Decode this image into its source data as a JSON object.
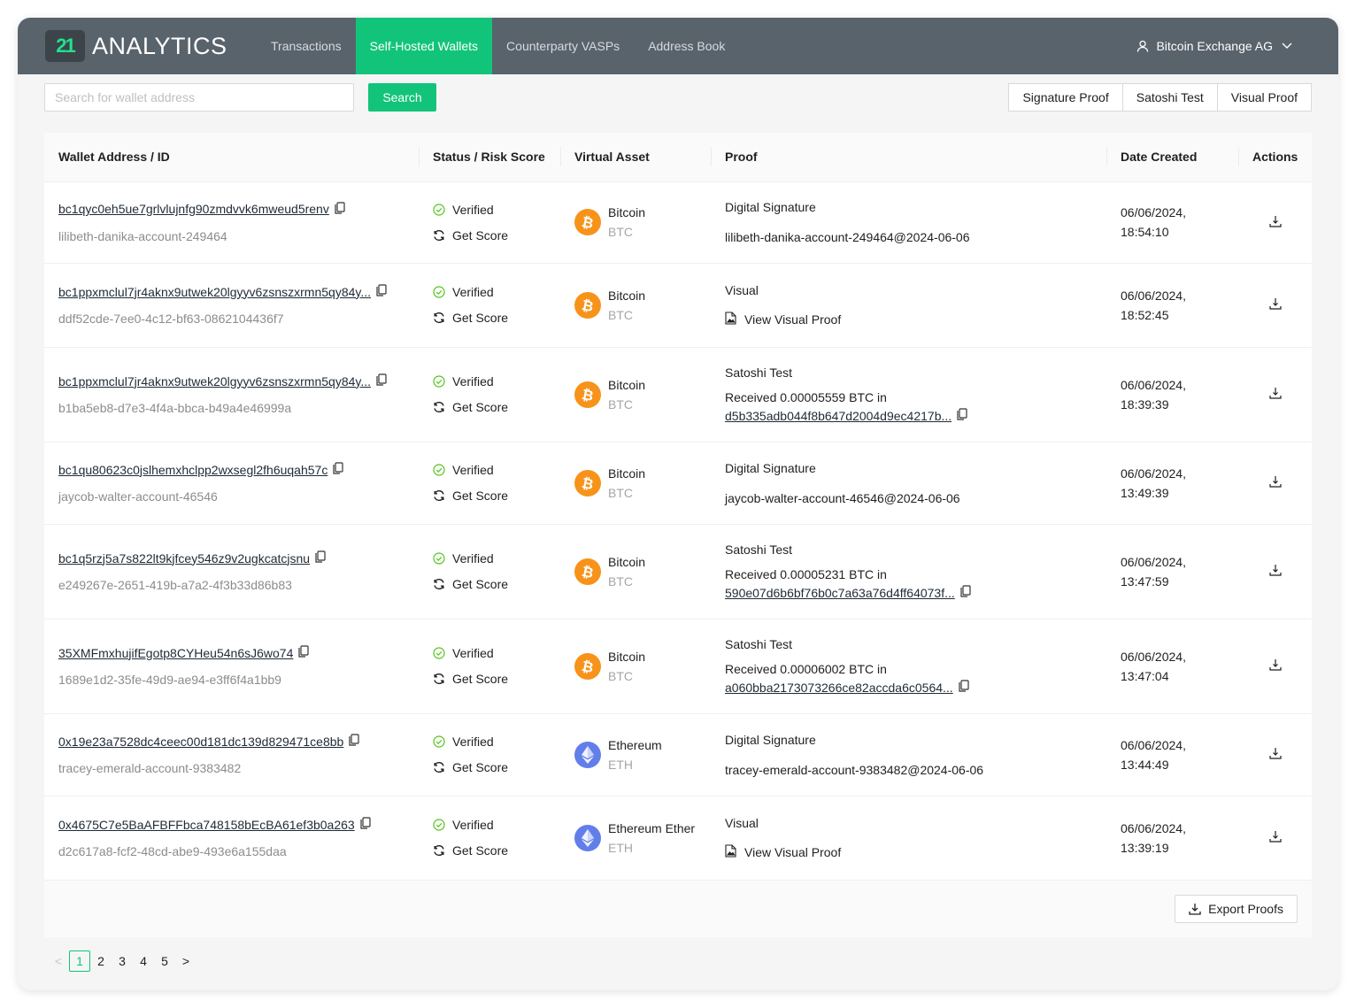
{
  "header": {
    "logo_badge": "21",
    "logo_text": "ANALYTICS",
    "nav": [
      {
        "label": "Transactions",
        "active": false
      },
      {
        "label": "Self-Hosted Wallets",
        "active": true
      },
      {
        "label": "Counterparty VASPs",
        "active": false
      },
      {
        "label": "Address Book",
        "active": false
      }
    ],
    "user": "Bitcoin Exchange AG",
    "user_icon": "user-icon",
    "dropdown_icon": "chevron-down-icon"
  },
  "toolbar": {
    "search_placeholder": "Search for wallet address",
    "search_value": "",
    "search_label": "Search",
    "proof_buttons": [
      "Signature Proof",
      "Satoshi Test",
      "Visual Proof"
    ]
  },
  "table": {
    "columns": [
      "Wallet Address / ID",
      "Status / Risk Score",
      "Virtual Asset",
      "Proof",
      "Date Created",
      "Actions"
    ],
    "rows": [
      {
        "address": "bc1qyc0eh5ue7grlvlujnfg90zmdvvk6mweud5renv",
        "id": "lilibeth-danika-account-249464",
        "status": "Verified",
        "score_label": "Get Score",
        "asset": "Bitcoin",
        "ticker": "BTC",
        "coin": "btc",
        "proof_type": "Digital Signature",
        "proof_kind": "signature",
        "proof_detail": "lilibeth-danika-account-249464@2024-06-06",
        "date": "06/06/2024,",
        "time": "18:54:10"
      },
      {
        "address": "bc1ppxmclul7jr4aknx9utwek20lgyyv6zsnszxrmn5qy84y...",
        "id": "ddf52cde-7ee0-4c12-bf63-0862104436f7",
        "status": "Verified",
        "score_label": "Get Score",
        "asset": "Bitcoin",
        "ticker": "BTC",
        "coin": "btc",
        "proof_type": "Visual",
        "proof_kind": "visual",
        "proof_detail": "View Visual Proof",
        "date": "06/06/2024,",
        "time": "18:52:45"
      },
      {
        "address": "bc1ppxmclul7jr4aknx9utwek20lgyyv6zsnszxrmn5qy84y...",
        "id": "b1ba5eb8-d7e3-4f4a-bbca-b49a4e46999a",
        "status": "Verified",
        "score_label": "Get Score",
        "asset": "Bitcoin",
        "ticker": "BTC",
        "coin": "btc",
        "proof_type": "Satoshi Test",
        "proof_kind": "satoshi",
        "proof_detail": "Received 0.00005559 BTC in",
        "proof_hash": "d5b335adb044f8b647d2004d9ec4217b...",
        "date": "06/06/2024,",
        "time": "18:39:39"
      },
      {
        "address": "bc1qu80623c0jslhemxhclpp2wxsegl2fh6uqah57c",
        "id": "jaycob-walter-account-46546",
        "status": "Verified",
        "score_label": "Get Score",
        "asset": "Bitcoin",
        "ticker": "BTC",
        "coin": "btc",
        "proof_type": "Digital Signature",
        "proof_kind": "signature",
        "proof_detail": "jaycob-walter-account-46546@2024-06-06",
        "date": "06/06/2024,",
        "time": "13:49:39"
      },
      {
        "address": "bc1q5rzj5a7s822lt9kjfcey546z9v2ugkcatcjsnu",
        "id": "e249267e-2651-419b-a7a2-4f3b33d86b83",
        "status": "Verified",
        "score_label": "Get Score",
        "asset": "Bitcoin",
        "ticker": "BTC",
        "coin": "btc",
        "proof_type": "Satoshi Test",
        "proof_kind": "satoshi",
        "proof_detail": "Received 0.00005231 BTC in",
        "proof_hash": "590e07d6b6bf76b0c7a63a76d4ff64073f...",
        "date": "06/06/2024,",
        "time": "13:47:59"
      },
      {
        "address": "35XMFmxhujifEgotp8CYHeu54n6sJ6wo74",
        "id": "1689e1d2-35fe-49d9-ae94-e3ff6f4a1bb9",
        "status": "Verified",
        "score_label": "Get Score",
        "asset": "Bitcoin",
        "ticker": "BTC",
        "coin": "btc",
        "proof_type": "Satoshi Test",
        "proof_kind": "satoshi",
        "proof_detail": "Received 0.00006002 BTC in",
        "proof_hash": "a060bba2173073266ce82accda6c0564...",
        "date": "06/06/2024,",
        "time": "13:47:04"
      },
      {
        "address": "0x19e23a7528dc4ceec00d181dc139d829471ce8bb",
        "id": "tracey-emerald-account-9383482",
        "status": "Verified",
        "score_label": "Get Score",
        "asset": "Ethereum",
        "ticker": "ETH",
        "coin": "eth",
        "proof_type": "Digital Signature",
        "proof_kind": "signature",
        "proof_detail": "tracey-emerald-account-9383482@2024-06-06",
        "date": "06/06/2024,",
        "time": "13:44:49"
      },
      {
        "address": "0x4675C7e5BaAFBFFbca748158bEcBA61ef3b0a263",
        "id": "d2c617a8-fcf2-48cd-abe9-493e6a155daa",
        "status": "Verified",
        "score_label": "Get Score",
        "asset": "Ethereum Ether",
        "ticker": "ETH",
        "coin": "eth",
        "proof_type": "Visual",
        "proof_kind": "visual",
        "proof_detail": "View Visual Proof",
        "date": "06/06/2024,",
        "time": "13:39:19"
      }
    ],
    "export_label": "Export Proofs"
  },
  "pagination": {
    "prev": "<",
    "next": ">",
    "pages": [
      "1",
      "2",
      "3",
      "4",
      "5"
    ],
    "current": "1"
  },
  "colors": {
    "header_bg": "#59636c",
    "accent": "#12c47a",
    "logo_green": "#20e38f",
    "verified_green": "#52c41a",
    "btc_orange": "#f7931a",
    "eth_blue": "#627eea"
  }
}
